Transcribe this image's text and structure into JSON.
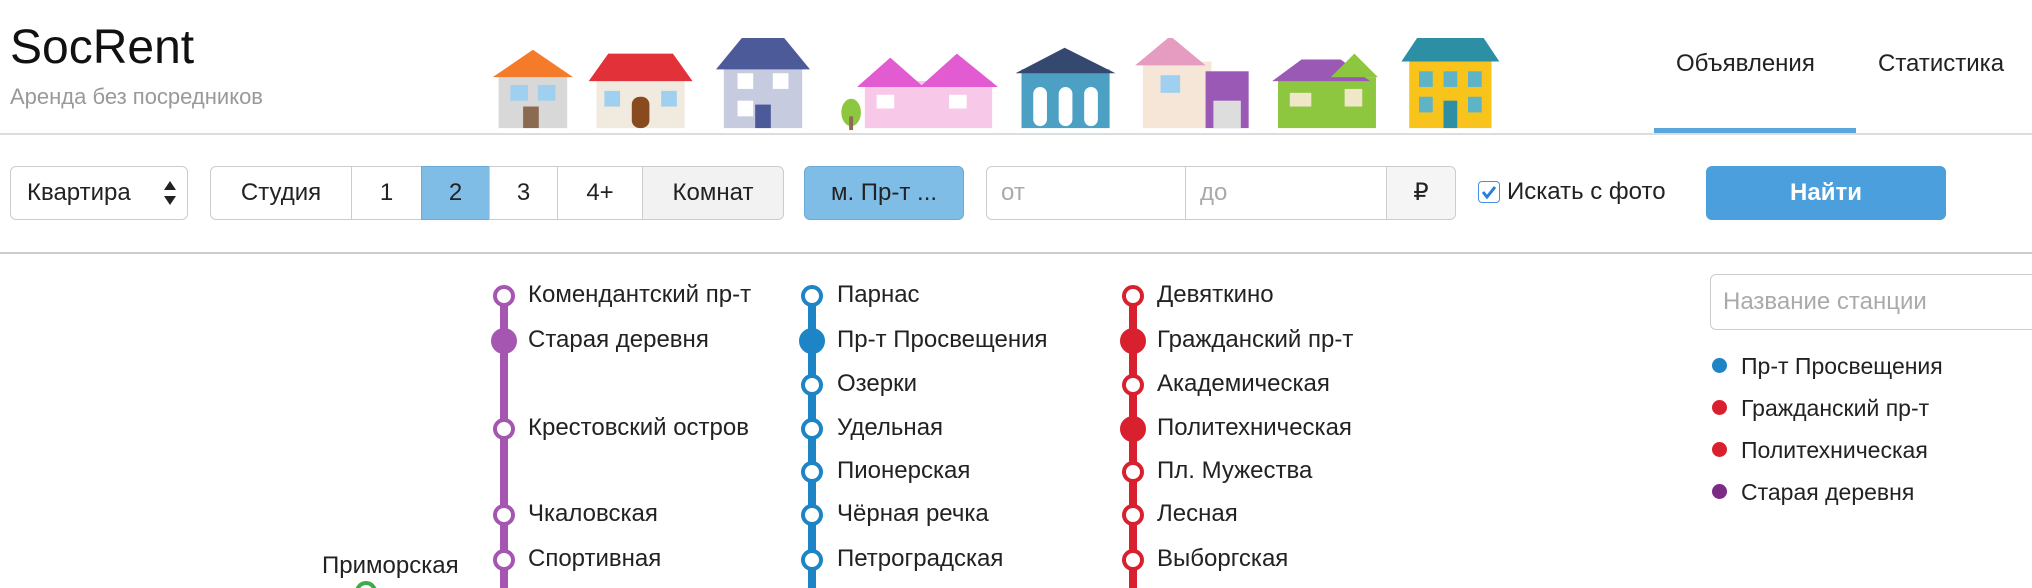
{
  "brand": {
    "title": "SocRent",
    "subtitle": "Аренда без посредников"
  },
  "nav": {
    "listings": "Объявления",
    "stats": "Статистика"
  },
  "filters": {
    "property_type": "Квартира",
    "rooms": [
      "Студия",
      "1",
      "2",
      "3",
      "4+",
      "Комнат"
    ],
    "active_room": "2",
    "metro_button": "м. Пр-т ...",
    "price_from_placeholder": "от",
    "price_to_placeholder": "до",
    "currency": "₽",
    "with_photo_label": "Искать с фото",
    "with_photo_checked": true,
    "search_button": "Найти"
  },
  "metro": {
    "purple_line": {
      "color": "#a456b1",
      "stations": [
        {
          "name": "Комендантский пр-т",
          "selected": false
        },
        {
          "name": "Старая деревня",
          "selected": true
        },
        {
          "name": "Крестовский остров",
          "selected": false
        },
        {
          "name": "Чкаловская",
          "selected": false
        },
        {
          "name": "Спортивная",
          "selected": false
        }
      ]
    },
    "blue_line": {
      "color": "#1d84c6",
      "stations": [
        {
          "name": "Парнас",
          "selected": false
        },
        {
          "name": "Пр-т Просвещения",
          "selected": true
        },
        {
          "name": "Озерки",
          "selected": false
        },
        {
          "name": "Удельная",
          "selected": false
        },
        {
          "name": "Пионерская",
          "selected": false
        },
        {
          "name": "Чёрная речка",
          "selected": false
        },
        {
          "name": "Петроградская",
          "selected": false
        }
      ]
    },
    "red_line": {
      "color": "#d9202e",
      "stations": [
        {
          "name": "Девяткино",
          "selected": false
        },
        {
          "name": "Гражданский пр-т",
          "selected": true
        },
        {
          "name": "Академическая",
          "selected": false
        },
        {
          "name": "Политехническая",
          "selected": true
        },
        {
          "name": "Пл. Мужества",
          "selected": false
        },
        {
          "name": "Лесная",
          "selected": false
        },
        {
          "name": "Выборгская",
          "selected": false
        }
      ]
    },
    "green_line": {
      "color": "#3cab4a",
      "stations": [
        {
          "name": "Приморская",
          "selected": false
        }
      ]
    }
  },
  "station_search": {
    "placeholder": "Название станции"
  },
  "selected_stations": [
    {
      "name": "Пр-т Просвещения",
      "color": "#1d84c6"
    },
    {
      "name": "Гражданский пр-т",
      "color": "#d9202e"
    },
    {
      "name": "Политехническая",
      "color": "#d9202e"
    },
    {
      "name": "Старая деревня",
      "color": "#7b2a86"
    }
  ]
}
